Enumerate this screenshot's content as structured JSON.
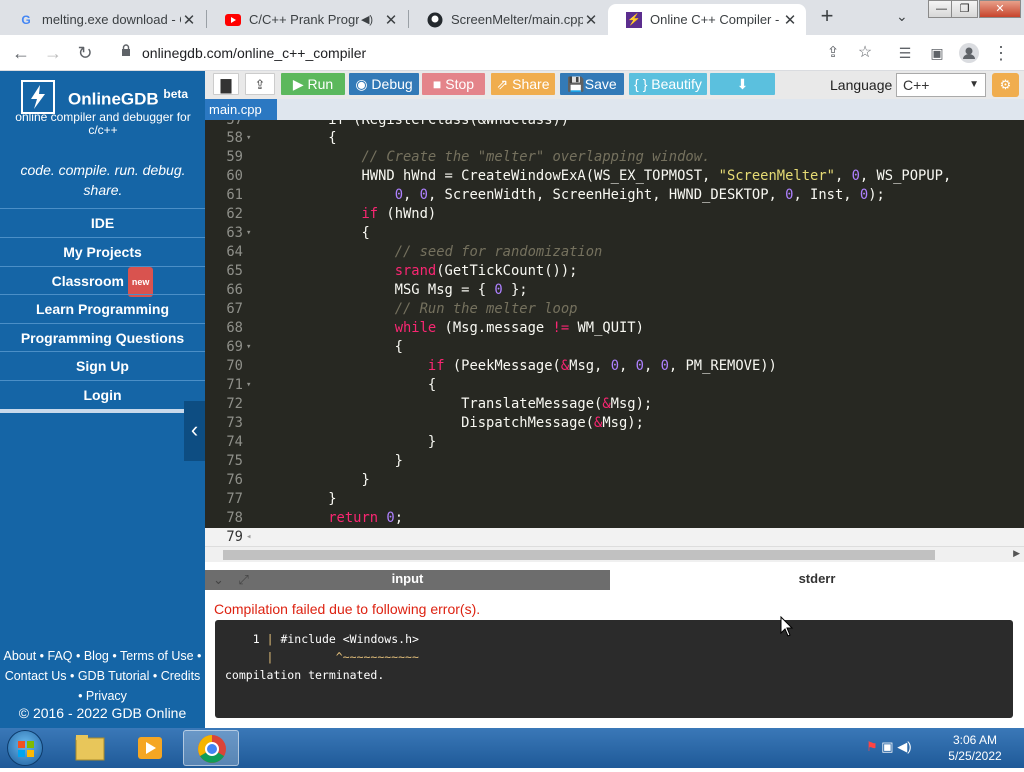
{
  "browser": {
    "tabs": [
      {
        "title": "melting.exe download - C",
        "icon": "google-g-icon"
      },
      {
        "title": "C/C++ Prank Program",
        "icon": "youtube-icon"
      },
      {
        "title": "ScreenMelter/main.cpp at",
        "icon": "github-icon"
      },
      {
        "title": "Online C++ Compiler - o",
        "icon": "onlinegdb-icon",
        "active": true
      }
    ],
    "url": "onlinegdb.com/online_c++_compiler"
  },
  "sidebar": {
    "brand": "OnlineGDB",
    "brand_sup": "beta",
    "tagline": "online compiler and debugger for c/c++",
    "motto": "code. compile. run. debug. share.",
    "nav": [
      {
        "label": "IDE"
      },
      {
        "label": "My Projects"
      },
      {
        "label": "Classroom",
        "badge": "new"
      },
      {
        "label": "Learn Programming"
      },
      {
        "label": "Programming Questions"
      },
      {
        "label": "Sign Up"
      },
      {
        "label": "Login"
      }
    ],
    "footer_line1": "About • FAQ • Blog • Terms of Use •",
    "footer_line2": "Contact Us • GDB Tutorial • Credits",
    "footer_line3": "• Privacy",
    "copyright": "© 2016 - 2022 GDB Online"
  },
  "toolbar": {
    "run": "Run",
    "debug": "Debug",
    "stop": "Stop",
    "share": "Share",
    "save": "Save",
    "beautify": "{ } Beautify",
    "language_label": "Language",
    "language_value": "C++"
  },
  "file_tab": "main.cpp",
  "output": {
    "tab_input": "input",
    "tab_stderr": "stderr",
    "error_message": "Compilation failed due to following error(s).",
    "console_line1_num": "1",
    "console_line1_text": " #include <Windows.h>",
    "console_line2_marker": "         ^~~~~~~~~~~~",
    "console_line3": "compilation terminated."
  },
  "taskbar": {
    "time": "3:06 AM",
    "date": "5/25/2022"
  },
  "colors": {
    "sidebar": "#1565a6",
    "editor_bg": "#272822",
    "run": "#5cb85c",
    "debug": "#337ab7",
    "stop": "#d9534f",
    "share": "#f0ad4e",
    "save": "#337ab7",
    "beautify": "#5bc0de"
  }
}
